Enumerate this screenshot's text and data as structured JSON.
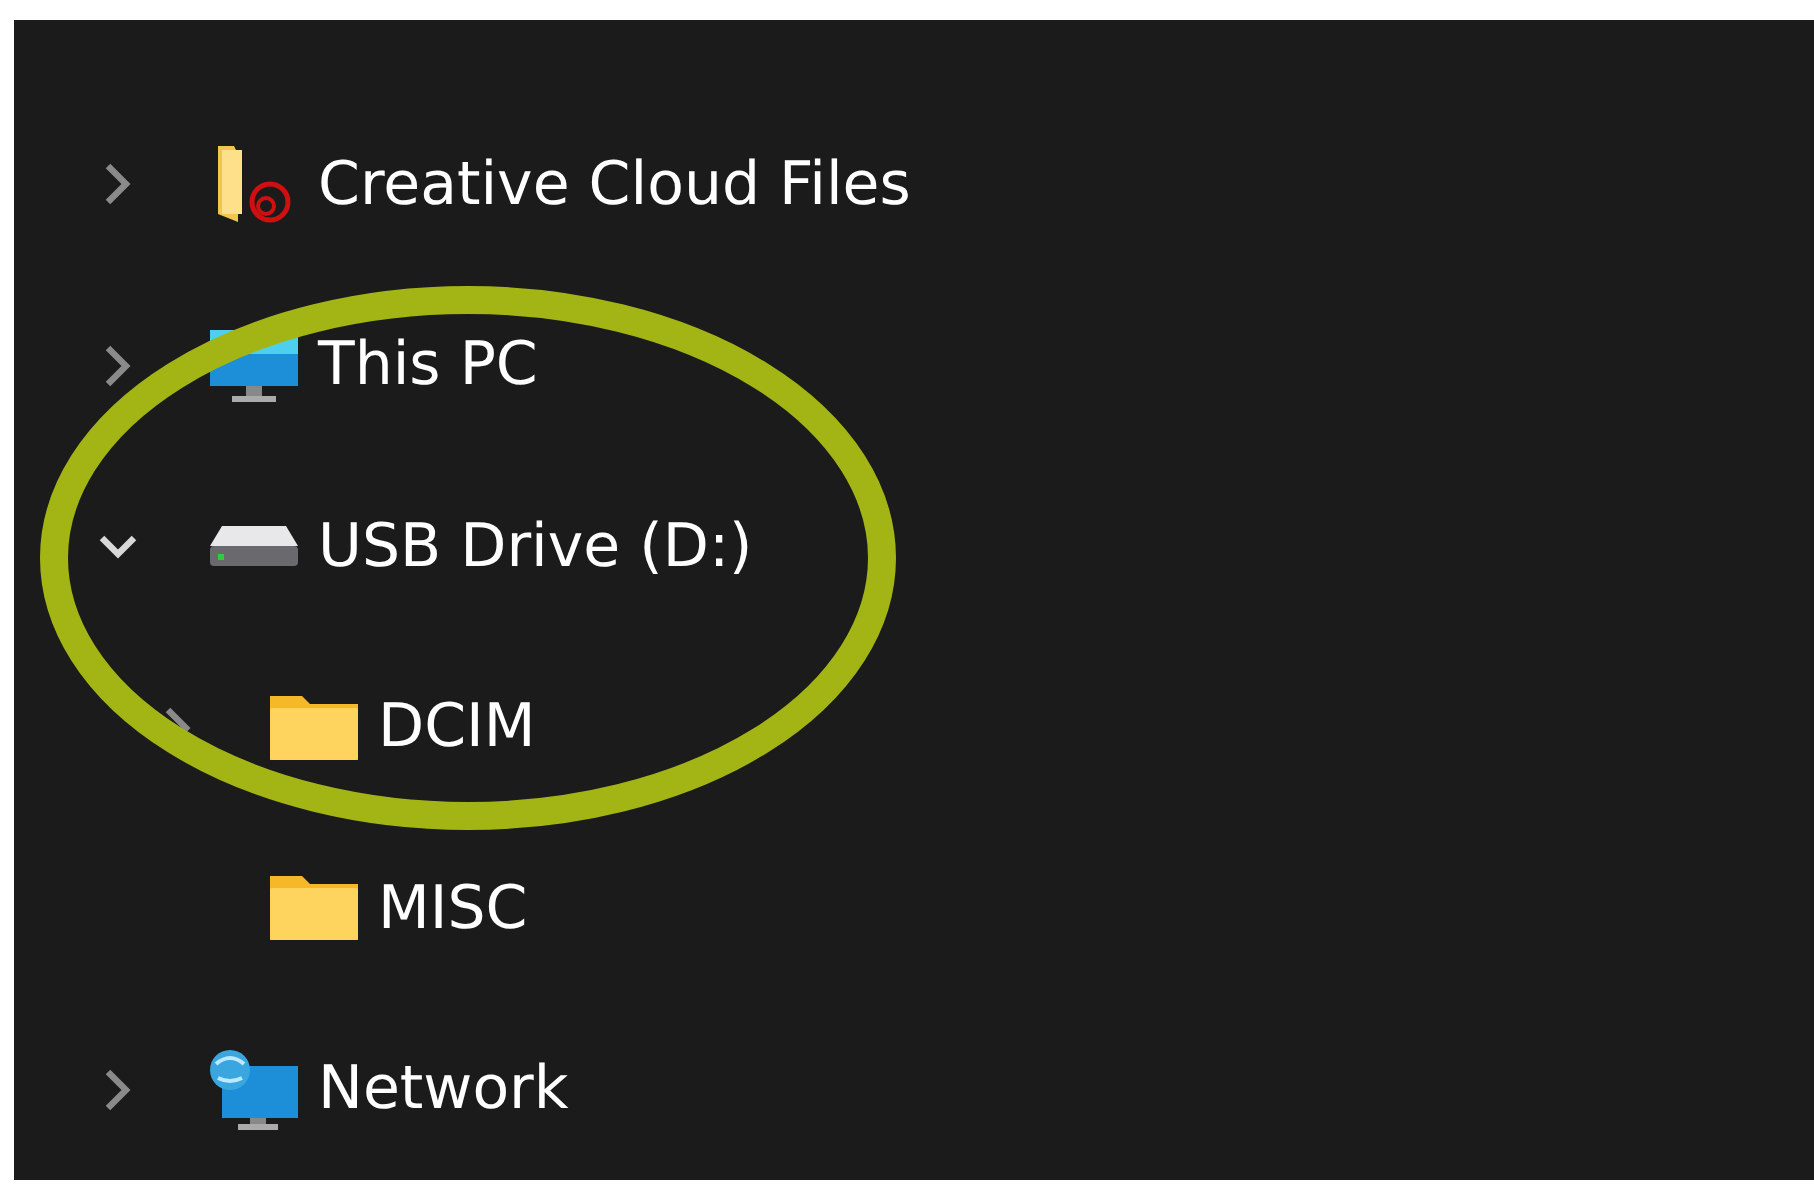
{
  "navigation_tree": [
    {
      "label": "Creative Cloud Files",
      "kind": "cloud-folder",
      "expandable": true,
      "expanded": false
    },
    {
      "label": "This PC",
      "kind": "computer",
      "expandable": true,
      "expanded": false
    },
    {
      "label": "USB Drive (D:)",
      "kind": "drive",
      "expandable": true,
      "expanded": true,
      "children": [
        {
          "label": "DCIM",
          "kind": "folder",
          "expandable": true,
          "expanded": false
        },
        {
          "label": "MISC",
          "kind": "folder",
          "expandable": false,
          "expanded": false
        }
      ]
    },
    {
      "label": "Network",
      "kind": "network",
      "expandable": true,
      "expanded": false
    }
  ]
}
